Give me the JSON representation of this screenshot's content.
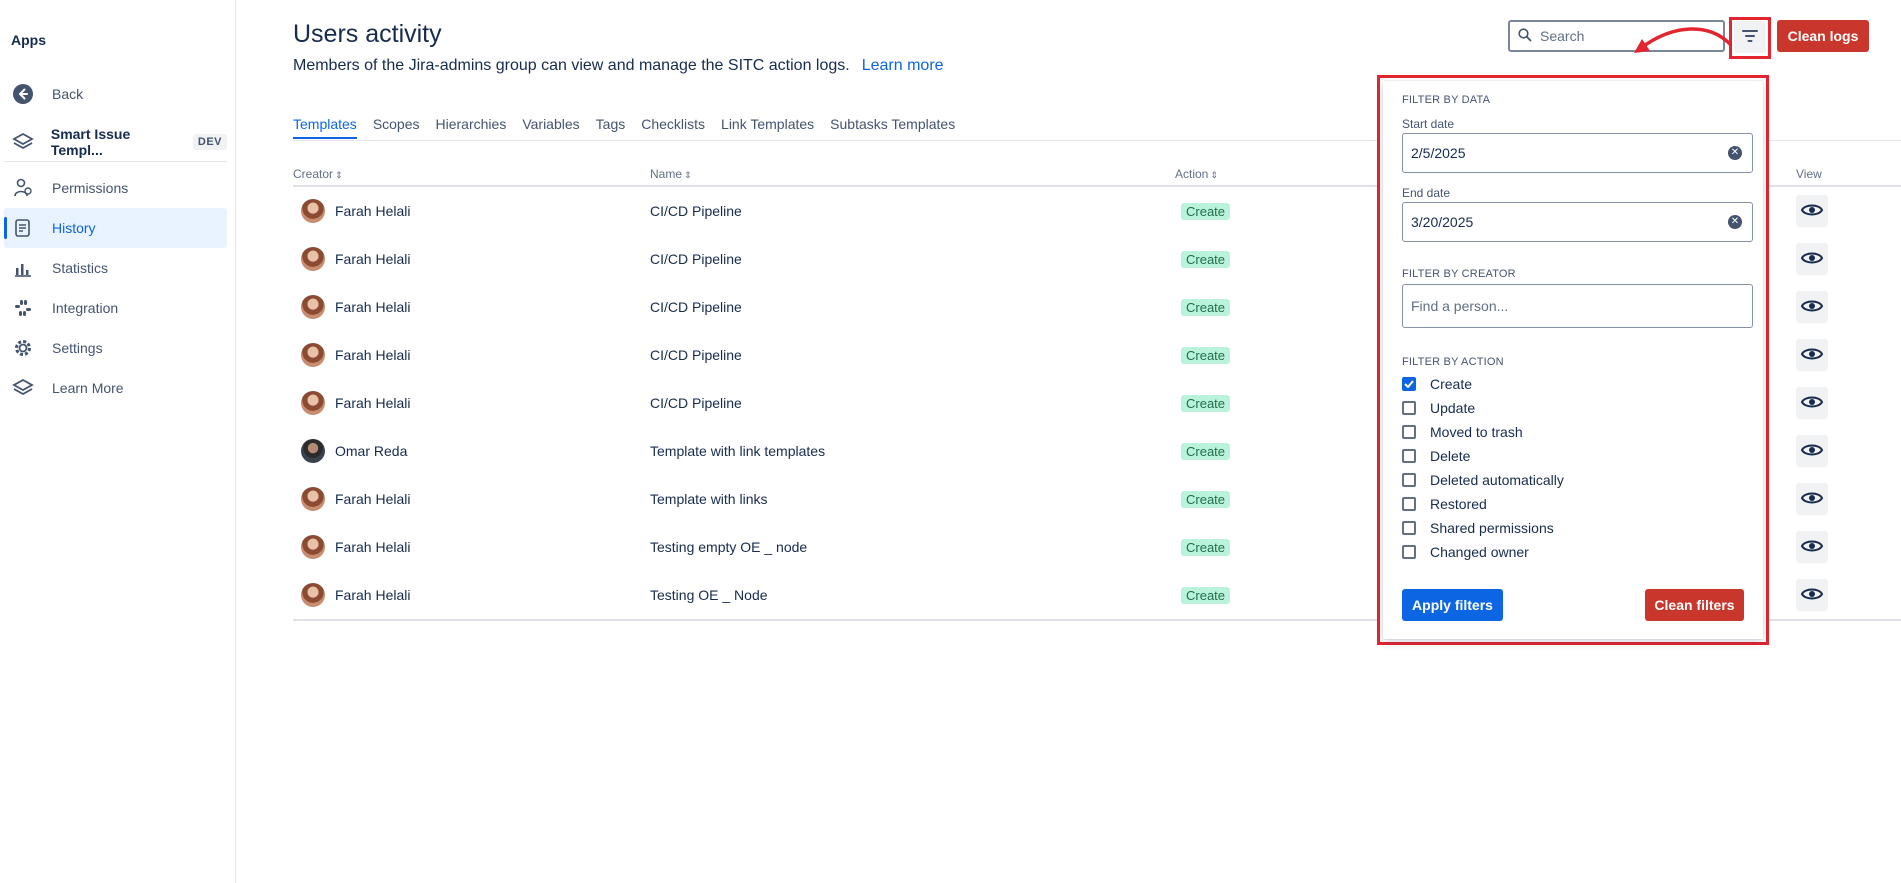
{
  "sidebar": {
    "apps_title": "Apps",
    "back_label": "Back",
    "app_name": "Smart Issue Templ...",
    "app_badge": "DEV",
    "items": [
      {
        "label": "Permissions",
        "icon": "permissions-icon"
      },
      {
        "label": "History",
        "icon": "history-icon",
        "active": true
      },
      {
        "label": "Statistics",
        "icon": "statistics-icon"
      },
      {
        "label": "Integration",
        "icon": "integration-icon"
      },
      {
        "label": "Settings",
        "icon": "gear-icon"
      },
      {
        "label": "Learn More",
        "icon": "learn-more-icon"
      }
    ]
  },
  "header": {
    "title": "Users activity",
    "subtitle": "Members of the Jira-admins group can view and manage the SITC action logs.",
    "learn_more": "Learn more",
    "search_placeholder": "Search",
    "clean_logs_label": "Clean logs"
  },
  "tabs": [
    "Templates",
    "Scopes",
    "Hierarchies",
    "Variables",
    "Tags",
    "Checklists",
    "Link Templates",
    "Subtasks Templates"
  ],
  "table": {
    "columns": {
      "creator": "Creator",
      "name": "Name",
      "action": "Action",
      "view": "View"
    },
    "rows": [
      {
        "creator": "Farah Helali",
        "name": "CI/CD Pipeline",
        "action": "Create"
      },
      {
        "creator": "Farah Helali",
        "name": "CI/CD Pipeline",
        "action": "Create"
      },
      {
        "creator": "Farah Helali",
        "name": "CI/CD Pipeline",
        "action": "Create"
      },
      {
        "creator": "Farah Helali",
        "name": "CI/CD Pipeline",
        "action": "Create"
      },
      {
        "creator": "Farah Helali",
        "name": "CI/CD Pipeline",
        "action": "Create"
      },
      {
        "creator": "Omar Reda",
        "name": "Template with link templates",
        "action": "Create"
      },
      {
        "creator": "Farah Helali",
        "name": "Template with links",
        "action": "Create"
      },
      {
        "creator": "Farah Helali",
        "name": "Testing empty OE _ node",
        "action": "Create"
      },
      {
        "creator": "Farah Helali",
        "name": "Testing OE _ Node",
        "action": "Create"
      }
    ]
  },
  "filter_panel": {
    "by_data_label": "FILTER BY DATA",
    "start_date_label": "Start date",
    "start_date_value": "2/5/2025",
    "end_date_label": "End date",
    "end_date_value": "3/20/2025",
    "by_creator_label": "FILTER BY CREATOR",
    "creator_placeholder": "Find a person...",
    "by_action_label": "FILTER BY ACTION",
    "actions": [
      {
        "label": "Create",
        "checked": true
      },
      {
        "label": "Update",
        "checked": false
      },
      {
        "label": "Moved to trash",
        "checked": false
      },
      {
        "label": "Delete",
        "checked": false
      },
      {
        "label": "Deleted automatically",
        "checked": false
      },
      {
        "label": "Restored",
        "checked": false
      },
      {
        "label": "Shared permissions",
        "checked": false
      },
      {
        "label": "Changed owner",
        "checked": false
      }
    ],
    "apply_label": "Apply filters",
    "clean_label": "Clean filters"
  },
  "colors": {
    "accent": "#0c66e4",
    "danger": "#c9372c",
    "highlight": "#e2252f",
    "lozenge_bg": "#baf3db",
    "lozenge_text": "#216e4e"
  }
}
